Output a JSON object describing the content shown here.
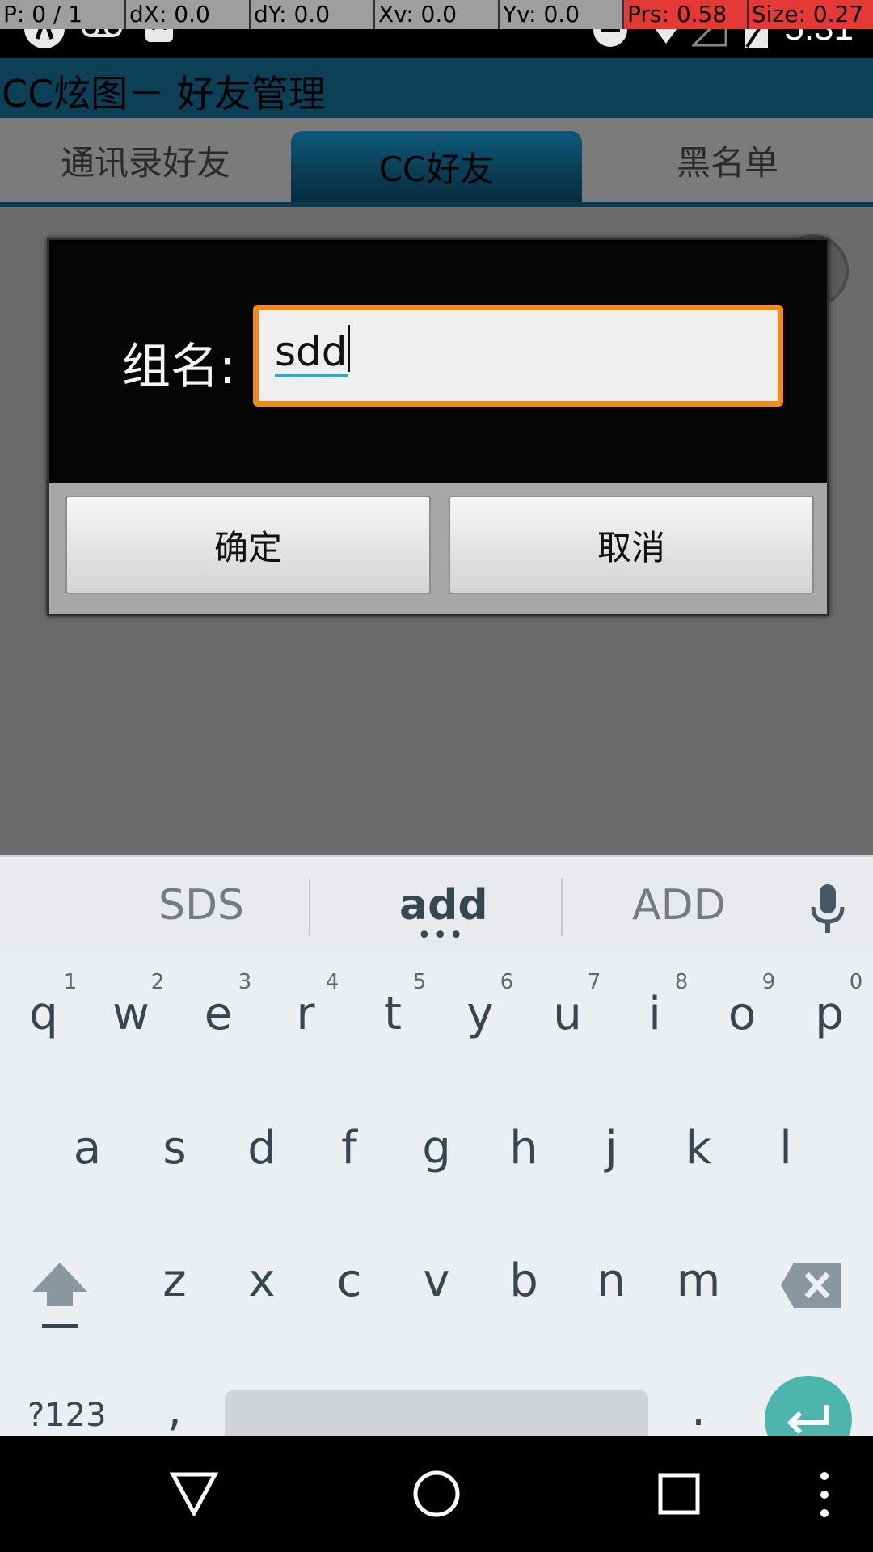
{
  "pointer_overlay": {
    "p": "P: 0 / 1",
    "dx": "dX: 0.0",
    "dy": "dY: 0.0",
    "xv": "Xv: 0.0",
    "yv": "Yv: 0.0",
    "prs": "Prs: 0.58",
    "size": "Size: 0.27"
  },
  "status_bar": {
    "time": "5:31"
  },
  "app": {
    "title": "CC炫图－ 好友管理",
    "tabs": [
      {
        "label": "通讯录好友",
        "active": false
      },
      {
        "label": "CC好友",
        "active": true
      },
      {
        "label": "黑名单",
        "active": false
      }
    ]
  },
  "dialog": {
    "label": "组名:",
    "input_value": "sdd",
    "confirm_label": "确定",
    "cancel_label": "取消"
  },
  "keyboard": {
    "suggestions": [
      "SDS",
      "add",
      "ADD"
    ],
    "row1": [
      "q",
      "w",
      "e",
      "r",
      "t",
      "y",
      "u",
      "i",
      "o",
      "p"
    ],
    "row1_hints": [
      "1",
      "2",
      "3",
      "4",
      "5",
      "6",
      "7",
      "8",
      "9",
      "0"
    ],
    "row2": [
      "a",
      "s",
      "d",
      "f",
      "g",
      "h",
      "j",
      "k",
      "l"
    ],
    "row3": [
      "z",
      "x",
      "c",
      "v",
      "b",
      "n",
      "m"
    ],
    "symbols_label": "?123",
    "comma": ",",
    "period": "."
  },
  "colors": {
    "title_bar": "#0c4057",
    "dialog_input_border": "#f28c17",
    "enter_key": "#4db6ac"
  }
}
